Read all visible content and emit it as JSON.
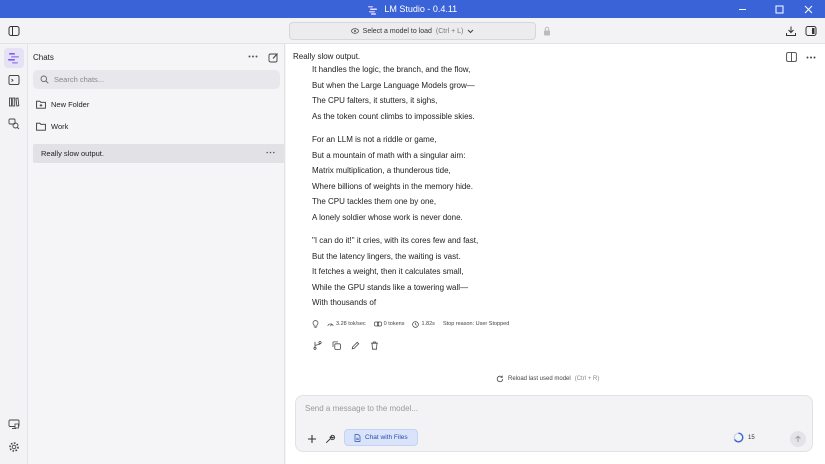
{
  "window": {
    "title": "LM Studio - 0.4.11",
    "accent": "#3b63d8",
    "controls": [
      "minimize",
      "maximize",
      "close"
    ]
  },
  "toolbar": {
    "model_select_label": "Select a model to load",
    "model_select_shortcut": "(Ctrl + L)"
  },
  "rail": {
    "items": [
      "chat-icon",
      "terminal-icon",
      "library-icon",
      "search-models-icon"
    ],
    "bottom_items": [
      "hardware-icon",
      "settings-icon"
    ]
  },
  "sidebar": {
    "title": "Chats",
    "search_placeholder": "Search chats...",
    "folders": [
      {
        "label": "New Folder"
      },
      {
        "label": "Work"
      }
    ],
    "chats": [
      {
        "label": "Really slow output.",
        "selected": true
      }
    ]
  },
  "chat": {
    "title": "Really slow output.",
    "stanzas": [
      [
        "It handles the logic, the branch, and the flow,",
        "But when the Large Language Models grow—",
        "The CPU falters, it stutters, it sighs,",
        "As the token count climbs to impossible skies."
      ],
      [
        "For an LLM is not a riddle or game,",
        "But a mountain of math with a singular aim:",
        "Matrix multiplication, a thunderous tide,",
        "Where billions of weights in the memory hide.",
        "The CPU tackles them one by one,",
        "A lonely soldier whose work is never done."
      ],
      [
        "\"I can do it!\" it cries, with its cores few and fast,",
        "But the latency lingers, the waiting is vast.",
        "It fetches a weight, then it calculates small,",
        "While the GPU stands like a towering wall—",
        "With thousands of"
      ]
    ],
    "stats": {
      "speed": "3.28 tok/sec",
      "tokens": "0 tokens",
      "time": "1.82s",
      "stop_reason": "Stop reason: User Stopped"
    },
    "reload_label": "Reload last used model",
    "reload_shortcut": "(Ctrl + R)"
  },
  "composer": {
    "placeholder": "Send a message to the model...",
    "files_button": "Chat with Files",
    "context_count": "15"
  }
}
